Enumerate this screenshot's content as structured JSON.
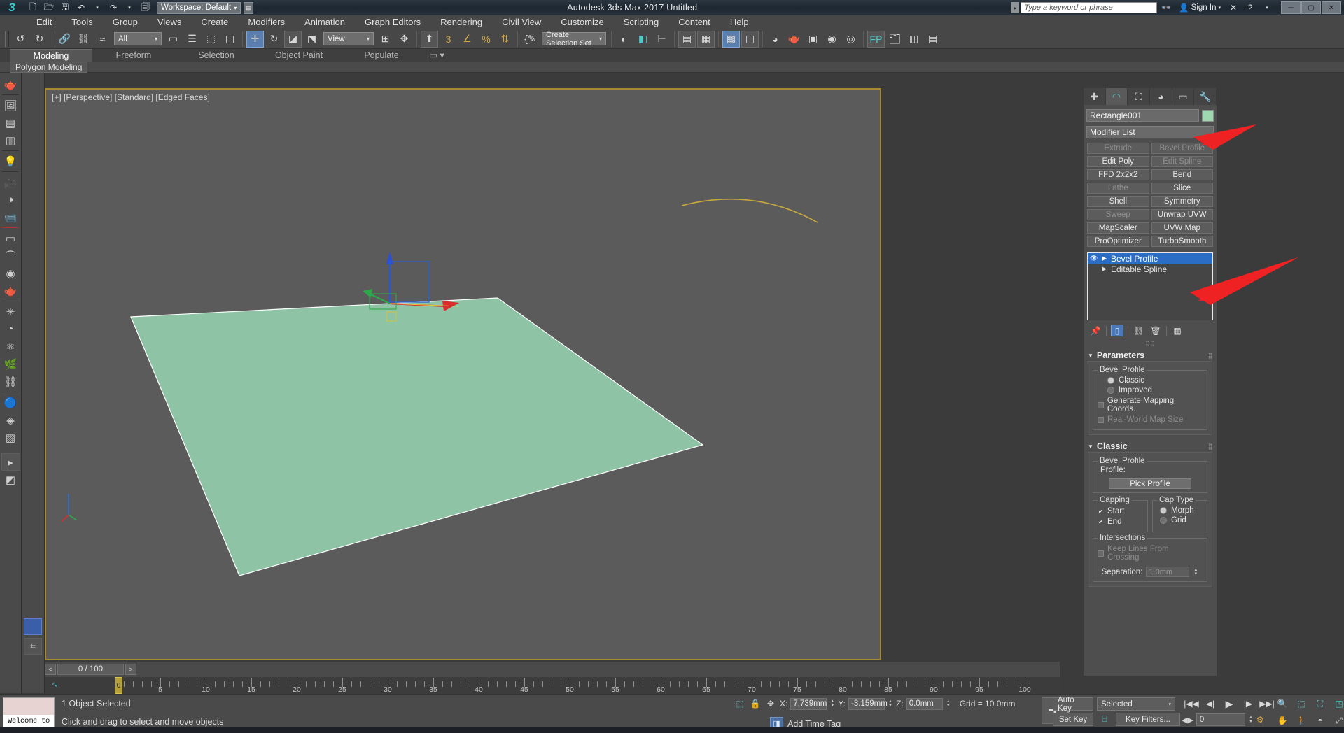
{
  "titlebar": {
    "logo": "3ds-max-logo",
    "quick_icons": [
      "new-file-icon",
      "open-folder-icon",
      "save-icon",
      "undo-icon",
      "redo-icon",
      "set-project-icon"
    ],
    "workspace_label": "Workspace: Default",
    "title": "Autodesk 3ds Max 2017        Untitled",
    "search_placeholder": "Type a keyword or phrase",
    "signin_label": "Sign In",
    "window_buttons": [
      "minimize",
      "maximize",
      "close"
    ]
  },
  "menubar": {
    "items": [
      "Edit",
      "Tools",
      "Group",
      "Views",
      "Create",
      "Modifiers",
      "Animation",
      "Graph Editors",
      "Rendering",
      "Civil View",
      "Customize",
      "Scripting",
      "Content",
      "Help"
    ]
  },
  "toolbar": {
    "selection_filter": "All",
    "reference_coord": "View",
    "named_selection_set": "Create Selection Set",
    "icons": [
      "undo-icon",
      "redo-icon",
      "select-link-icon",
      "unlink-icon",
      "bind-space-warp-icon",
      "selection-filter",
      "select-object-icon",
      "select-by-name-icon",
      "rectangular-region-icon",
      "window-crossing-icon",
      "select-and-move-icon",
      "select-and-rotate-icon",
      "select-and-scale-icon",
      "placement-icon",
      "coordinate-system",
      "use-pivot-center-icon",
      "select-and-manipulate-icon",
      "snaps-toggle-icon",
      "angle-snap-icon",
      "percent-snap-icon",
      "spinner-snap-icon",
      "edit-named-selection-icon",
      "mirror-icon",
      "align-icon",
      "layer-explorer-icon",
      "scene-explorer-icon",
      "curve-editor-icon",
      "schematic-view-icon",
      "material-editor-icon",
      "render-setup-icon",
      "rendered-frame-icon",
      "render-production-icon",
      "render-frame-window-icon",
      "project-folder-icon"
    ]
  },
  "ribbon": {
    "tabs": [
      "Modeling",
      "Freeform",
      "Selection",
      "Object Paint",
      "Populate"
    ],
    "active_tab": "Modeling",
    "subtab": "Polygon Modeling"
  },
  "viewport": {
    "label": "[+] [Perspective] [Standard] [Edged Faces]",
    "object_color": "#8fc3a5",
    "spline_color": "#c8a93c",
    "border_color": "#a88a33"
  },
  "timeline": {
    "prev_label": "<",
    "next_label": ">",
    "frame_display": "0 / 100",
    "ticks": [
      0,
      5,
      10,
      15,
      20,
      25,
      30,
      35,
      40,
      45,
      50,
      55,
      60,
      65,
      70,
      75,
      80,
      85,
      90,
      95,
      100
    ],
    "playhead_label": "0"
  },
  "statusbar": {
    "max_logo_text": "Welcome to MAX",
    "line1": "1 Object Selected",
    "line2": "Click and drag to select and move objects",
    "coords": {
      "x_label": "X:",
      "x_value": "7.739mm",
      "y_label": "Y:",
      "y_value": "-3.159mm",
      "z_label": "Z:",
      "z_value": "0.0mm",
      "grid": "Grid = 10.0mm"
    },
    "add_time_tag": "Add Time Tag",
    "auto_key": "Auto Key",
    "set_key": "Set Key",
    "selection_mode": "Selected",
    "key_filters": "Key Filters...",
    "key_value": "0",
    "nav_icons": [
      "zoom-icon",
      "zoom-all-icon",
      "zoom-extents-icon",
      "zoom-region-icon",
      "pan-icon",
      "orbit-icon",
      "walkthrough-icon",
      "arc-rotate-icon",
      "maximize-viewport-icon"
    ],
    "playback_icons": [
      "go-to-start-icon",
      "previous-frame-icon",
      "play-icon",
      "next-frame-icon",
      "go-to-end-icon"
    ]
  },
  "command_panel": {
    "tabs": [
      {
        "name": "create-tab",
        "icon": "plus-icon",
        "selected": false
      },
      {
        "name": "modify-tab",
        "icon": "modify-icon",
        "selected": true
      },
      {
        "name": "hierarchy-tab",
        "icon": "hierarchy-icon",
        "selected": false
      },
      {
        "name": "motion-tab",
        "icon": "motion-icon",
        "selected": false
      },
      {
        "name": "display-tab",
        "icon": "display-icon",
        "selected": false
      },
      {
        "name": "utilities-tab",
        "icon": "wrench-icon",
        "selected": false
      }
    ],
    "object_name": "Rectangle001",
    "object_color": "#9fd7b1",
    "modifier_list_label": "Modifier List",
    "modifier_buttons": [
      {
        "label": "Extrude",
        "dim": true
      },
      {
        "label": "Bevel Profile",
        "dim": true
      },
      {
        "label": "Edit Poly",
        "dim": false
      },
      {
        "label": "Edit Spline",
        "dim": true
      },
      {
        "label": "FFD 2x2x2",
        "dim": false
      },
      {
        "label": "Bend",
        "dim": false
      },
      {
        "label": "Lathe",
        "dim": true
      },
      {
        "label": "Slice",
        "dim": false
      },
      {
        "label": "Shell",
        "dim": false
      },
      {
        "label": "Symmetry",
        "dim": false
      },
      {
        "label": "Sweep",
        "dim": true
      },
      {
        "label": "Unwrap UVW",
        "dim": false
      },
      {
        "label": "MapScaler",
        "dim": false
      },
      {
        "label": "UVW Map",
        "dim": false
      },
      {
        "label": "ProOptimizer",
        "dim": false
      },
      {
        "label": "TurboSmooth",
        "dim": false
      }
    ],
    "modifier_stack": [
      {
        "label": "Bevel Profile",
        "selected": true,
        "has_eye": true
      },
      {
        "label": "Editable Spline",
        "selected": false,
        "has_eye": false
      }
    ],
    "stack_tools": [
      "pin-stack-icon",
      "show-end-result-icon",
      "make-unique-icon",
      "remove-modifier-icon",
      "configure-modifier-sets-icon"
    ],
    "rollouts": {
      "parameters": {
        "title": "Parameters",
        "group_title": "Bevel Profile",
        "radio_options": [
          {
            "label": "Classic",
            "selected": true
          },
          {
            "label": "Improved",
            "selected": false
          }
        ],
        "checkboxes": [
          {
            "label": "Generate Mapping Coords.",
            "checked": false,
            "disabled": false
          },
          {
            "label": "Real-World Map Size",
            "checked": false,
            "disabled": true
          }
        ]
      },
      "classic": {
        "title": "Classic",
        "bevel_group_title": "Bevel Profile",
        "profile_label": "Profile:",
        "pick_profile_button": "Pick Profile",
        "capping_title": "Capping",
        "capping_items": [
          {
            "label": "Start",
            "checked": true
          },
          {
            "label": "End",
            "checked": true
          }
        ],
        "cap_type_title": "Cap Type",
        "cap_type_items": [
          {
            "label": "Morph",
            "selected": true
          },
          {
            "label": "Grid",
            "selected": false
          }
        ],
        "intersections_title": "Intersections",
        "keep_lines_label": "Keep Lines From Crossing",
        "separation_label": "Separation:",
        "separation_value": "1.0mm"
      }
    }
  },
  "annotations": {
    "arrow_color": "#ee2222",
    "arrows": [
      "arrow-to-modifier-list",
      "arrow-to-bevel-profile-stack-entry"
    ]
  }
}
